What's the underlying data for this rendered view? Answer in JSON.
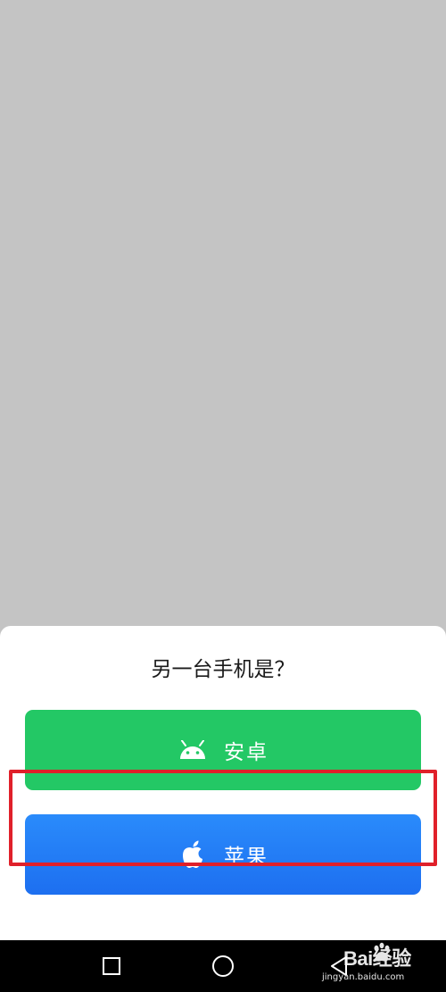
{
  "sheet": {
    "title": "另一台手机是？",
    "android_button": {
      "label": "安卓",
      "icon": "android-icon",
      "color": "#23c865"
    },
    "apple_button": {
      "label": "苹果",
      "icon": "apple-icon",
      "color": "#1d6ff0"
    },
    "highlight_color": "#e0202a"
  },
  "navbar": {
    "recents": "square-icon",
    "home": "circle-icon",
    "back": "triangle-back-icon"
  },
  "watermark": {
    "brand": "Bai经验",
    "domain": "jingyan.baidu.com"
  }
}
